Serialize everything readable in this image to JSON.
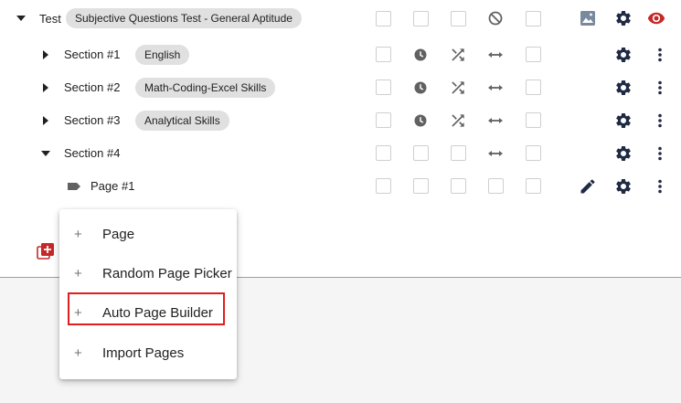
{
  "test": {
    "label": "Test",
    "title_chip": "Subjective Questions Test - General Aptitude"
  },
  "sections": [
    {
      "label": "Section #1",
      "chip": "English"
    },
    {
      "label": "Section #2",
      "chip": "Math-Coding-Excel Skills"
    },
    {
      "label": "Section #3",
      "chip": "Analytical Skills"
    },
    {
      "label": "Section #4",
      "chip": ""
    }
  ],
  "page": {
    "label": "Page #1"
  },
  "menu": {
    "items": [
      {
        "label": "Page"
      },
      {
        "label": "Random Page Picker"
      },
      {
        "label": "Auto Page Builder"
      },
      {
        "label": "Import Pages"
      }
    ],
    "highlighted_item": "Auto Page Builder"
  },
  "colors": {
    "accent_red": "#c62828",
    "icon_gray": "#616161",
    "icon_navy": "#1f2a44",
    "highlight": "#e01e1e",
    "chip_bg": "#e0e0e0"
  },
  "icons": [
    "caret-down-icon",
    "caret-right-icon",
    "clock-icon",
    "shuffle-icon",
    "arrows-horizontal-icon",
    "block-icon",
    "image-icon",
    "gear-icon",
    "eye-icon",
    "more-vert-icon",
    "edit-icon",
    "label-icon",
    "add-box-icon",
    "plus-icon"
  ]
}
